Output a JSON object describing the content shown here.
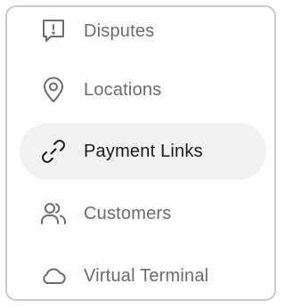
{
  "menu": {
    "items": [
      {
        "label": "Disputes",
        "icon": "message-alert-icon",
        "active": false
      },
      {
        "label": "Locations",
        "icon": "map-pin-icon",
        "active": false
      },
      {
        "label": "Payment Links",
        "icon": "link-icon",
        "active": true
      },
      {
        "label": "Customers",
        "icon": "users-icon",
        "active": false
      },
      {
        "label": "Virtual Terminal",
        "icon": "cloud-icon",
        "active": false
      }
    ]
  },
  "colors": {
    "icon_inactive": "#6b6b6b",
    "icon_active": "#1a1a1a",
    "active_background": "#f1f1f1",
    "border": "#c9c9c9"
  }
}
